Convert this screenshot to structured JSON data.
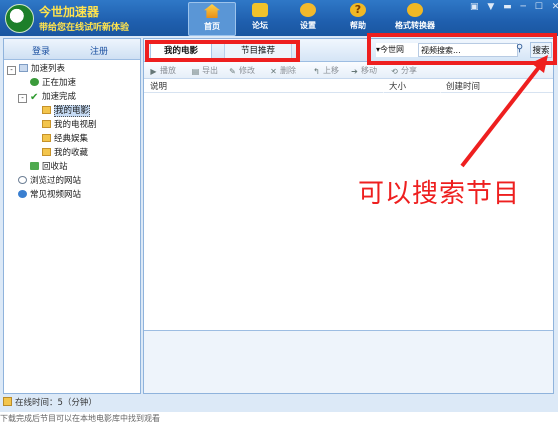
{
  "app": {
    "name": "今世加速器",
    "slogan": "带给您在线试听新体验"
  },
  "nav": {
    "home": "首页",
    "forum": "论坛",
    "settings": "设置",
    "help": "帮助",
    "convert": "格式转换器"
  },
  "window_controls": "▣ ▼ ▬ ─ ☐ ✕",
  "left": {
    "login": "登录",
    "register": "注册",
    "tree": {
      "root": "加速列表",
      "accelerating": "正在加速",
      "completed": "加速完成",
      "my_movies": "我的电影",
      "my_tv": "我的电视剧",
      "classics": "经典娱集",
      "favorites": "我的收藏",
      "recycle": "回收站",
      "browsed": "浏览过的网站",
      "common_sites": "常见视频网站"
    },
    "status": "在线时间：5（分钟）"
  },
  "main": {
    "tabs": [
      "我的电影",
      "节目推荐"
    ],
    "search": {
      "source": "▾今世网",
      "placeholder": "视频搜索...",
      "button": "搜索"
    },
    "toolbar": {
      "play": "播放",
      "export": "导出",
      "edit": "修改",
      "delete": "删除",
      "up": "上移",
      "move": "移动",
      "share": "分享"
    },
    "columns": {
      "name": "说明",
      "size": "大小",
      "created": "创建时间"
    }
  },
  "annotation": "可以搜索节目",
  "caption": "下载完成后节目可以在本地电影库中找到观看"
}
